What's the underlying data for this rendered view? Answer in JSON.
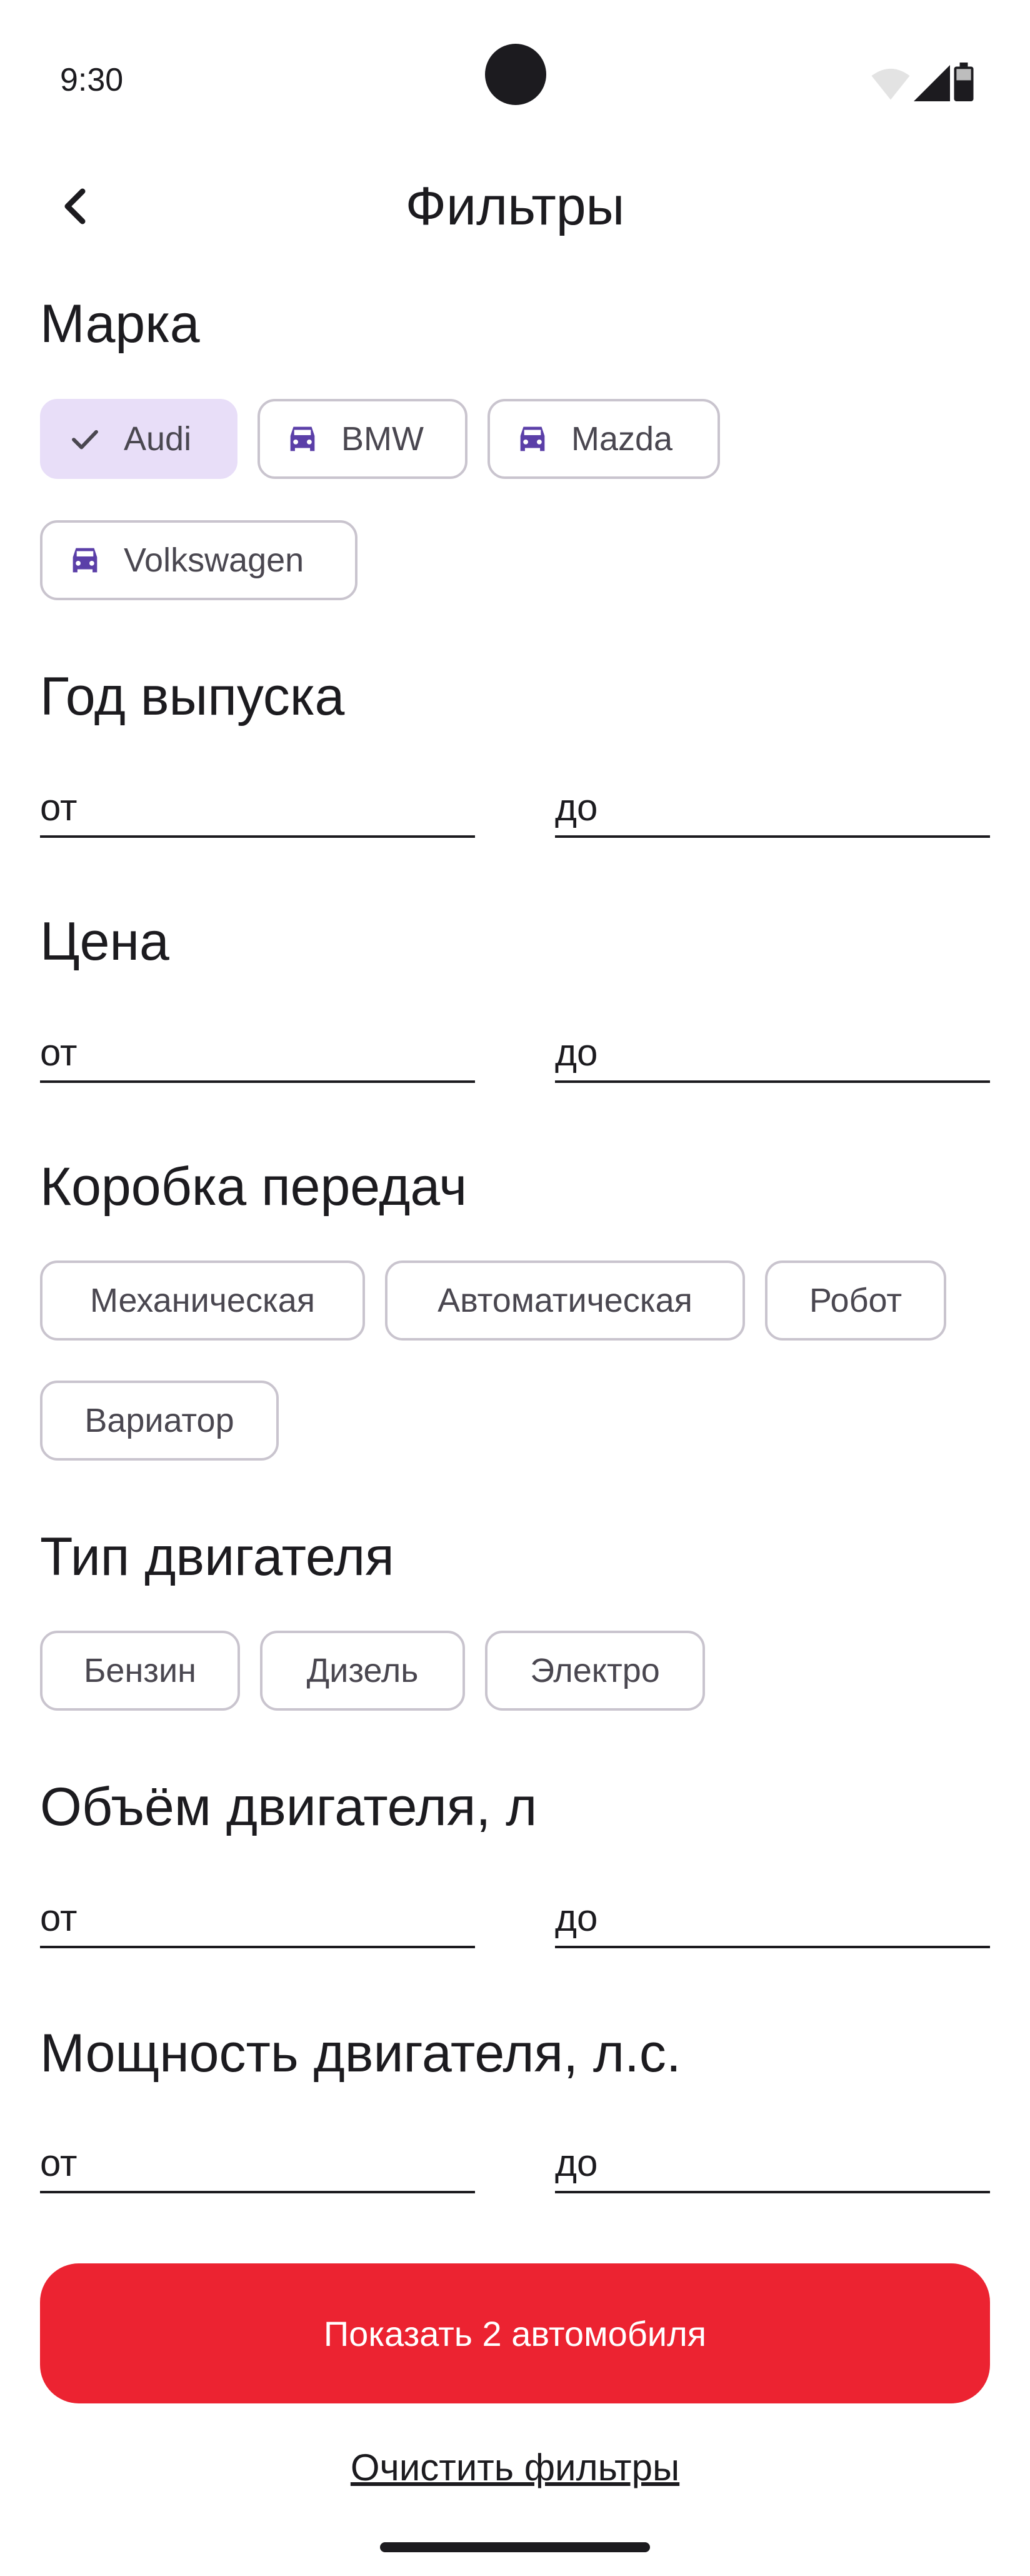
{
  "status_bar": {
    "time": "9:30"
  },
  "header": {
    "title": "Фильтры",
    "back_icon": "chevron-left-icon"
  },
  "brand": {
    "title": "Марка",
    "chips": [
      {
        "label": "Audi",
        "selected": true,
        "icon": "check-icon"
      },
      {
        "label": "BMW",
        "selected": false,
        "icon": "car-icon"
      },
      {
        "label": "Mazda",
        "selected": false,
        "icon": "car-icon"
      },
      {
        "label": "Volkswagen",
        "selected": false,
        "icon": "car-icon"
      }
    ]
  },
  "year": {
    "title": "Год выпуска",
    "from_placeholder": "от",
    "to_placeholder": "до"
  },
  "price": {
    "title": "Цена",
    "from_placeholder": "от",
    "to_placeholder": "до"
  },
  "transmission": {
    "title": "Коробка передач",
    "chips": [
      "Механическая",
      "Автоматическая",
      "Робот",
      "Вариатор"
    ]
  },
  "engine_type": {
    "title": "Тип двигателя",
    "chips": [
      "Бензин",
      "Дизель",
      "Электро"
    ]
  },
  "engine_volume": {
    "title": "Объём двигателя, л",
    "from_placeholder": "от",
    "to_placeholder": "до"
  },
  "engine_power": {
    "title": "Мощность двигателя, л.с.",
    "from_placeholder": "от",
    "to_placeholder": "до"
  },
  "actions": {
    "show_button": "Показать 2 автомобиля",
    "clear_link": "Очистить фильтры"
  },
  "colors": {
    "accent_red": "#ec2331",
    "selected_chip_bg": "#e8def8",
    "icon_purple": "#5b3fa8"
  }
}
